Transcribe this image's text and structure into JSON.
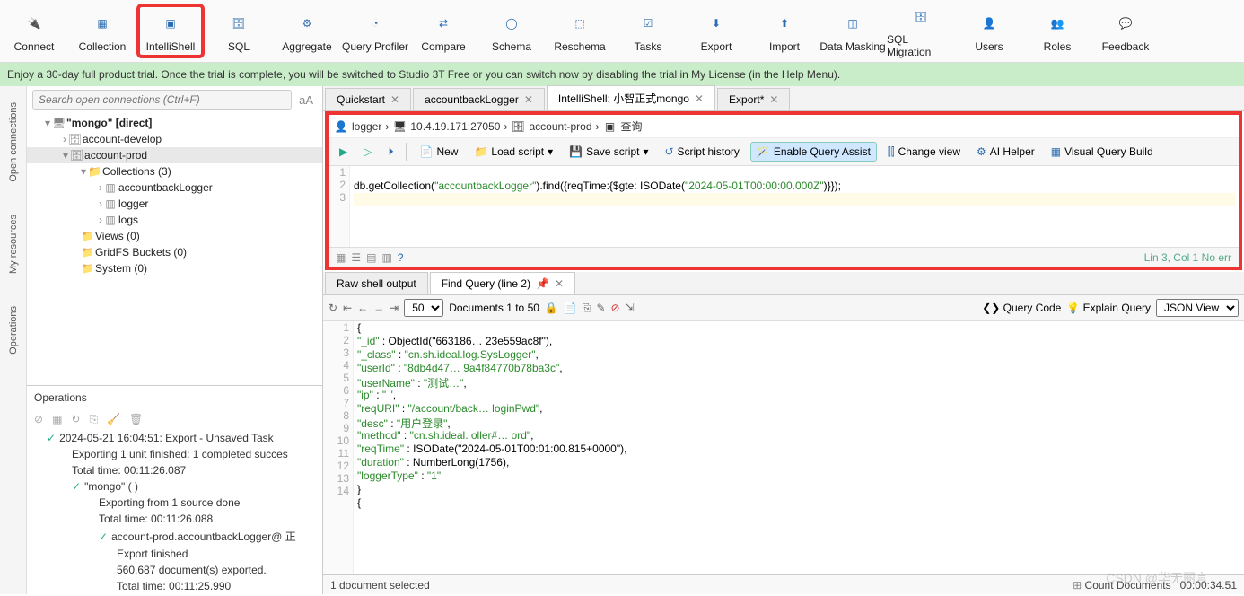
{
  "toolbar": [
    {
      "id": "connect",
      "label": "Connect"
    },
    {
      "id": "collection",
      "label": "Collection"
    },
    {
      "id": "intellishell",
      "label": "IntelliShell",
      "highlight": true
    },
    {
      "id": "sql",
      "label": "SQL"
    },
    {
      "id": "aggregate",
      "label": "Aggregate"
    },
    {
      "id": "queryprofiler",
      "label": "Query Profiler"
    },
    {
      "id": "compare",
      "label": "Compare"
    },
    {
      "id": "schema",
      "label": "Schema"
    },
    {
      "id": "reschema",
      "label": "Reschema"
    },
    {
      "id": "tasks",
      "label": "Tasks"
    },
    {
      "id": "export",
      "label": "Export"
    },
    {
      "id": "import",
      "label": "Import"
    },
    {
      "id": "datamasking",
      "label": "Data Masking"
    },
    {
      "id": "sqlmigration",
      "label": "SQL Migration"
    },
    {
      "id": "users",
      "label": "Users"
    },
    {
      "id": "roles",
      "label": "Roles"
    },
    {
      "id": "feedback",
      "label": "Feedback"
    }
  ],
  "banner": "Enjoy a 30-day full product trial. Once the trial is complete, you will be switched to Studio 3T Free or you can switch now by disabling the trial in My License (in the Help Menu).",
  "left": {
    "search_placeholder": "Search open connections (Ctrl+F)",
    "side_tabs": [
      "Open connections",
      "My resources",
      "Operations"
    ],
    "tree": {
      "root": "\"mongo\"            [direct]",
      "items": [
        "account-develop",
        "account-prod",
        "Collections (3)",
        "accountbackLogger",
        "logger",
        "logs",
        "Views (0)",
        "GridFS Buckets (0)",
        "System (0)"
      ]
    },
    "ops_header": "Operations",
    "ops": [
      {
        "t": "2024-05-21 16:04:51:  Export - Unsaved Task"
      },
      {
        "t": "Exporting 1 unit finished: 1 completed succes"
      },
      {
        "t": "Total time: 00:11:26.087"
      },
      {
        "t": "\"mongo\" (                        )"
      },
      {
        "t": "Exporting from 1 source done"
      },
      {
        "t": "Total time: 00:11:26.088"
      },
      {
        "t": "account-prod.accountbackLogger@      正"
      },
      {
        "t": "Export finished"
      },
      {
        "t": "560,687 document(s) exported."
      },
      {
        "t": "Total time: 00:11:25.990"
      }
    ]
  },
  "tabs": [
    {
      "label": "Quickstart"
    },
    {
      "label": "accountbackLogger"
    },
    {
      "label": "IntelliShell: 小智正式mongo",
      "active": true
    },
    {
      "label": "Export*"
    }
  ],
  "crumb": {
    "user": "logger",
    "host": "10.4.19.171:27050",
    "db": "account-prod",
    "cmd": "查询"
  },
  "querybar": {
    "new": "New",
    "load": "Load script",
    "save": "Save script",
    "history": "Script history",
    "assist": "Enable Query Assist",
    "changeview": "Change view",
    "aihelper": "AI Helper",
    "vqb": "Visual Query Build"
  },
  "editor": {
    "lines": [
      "1",
      "2",
      "3"
    ],
    "code": "db.getCollection(\"accountbackLogger\").find({reqTime:{$gte: ISODate(\"2024-05-01T00:00:00.000Z\")}});"
  },
  "status_right": "Lin 3, Col 1  No err",
  "result_tabs": [
    "Raw shell output",
    "Find Query (line 2)"
  ],
  "result_bar": {
    "page_size": "50",
    "docs": "Documents 1 to 50",
    "query_code": "Query Code",
    "explain": "Explain Query",
    "view": "JSON View"
  },
  "result_lines": [
    "1",
    "2",
    "3",
    "4",
    "5",
    "6",
    "7",
    "8",
    "9",
    "10",
    "11",
    "12",
    "13",
    "14"
  ],
  "result_json": [
    "{",
    "    \"_id\" : ObjectId(\"663186…        23e559ac8f\"),",
    "    \"_class\" : \"cn.sh.ideal.log.SysLogger\",",
    "    \"userId\" : \"8db4d47…         9a4f84770b78ba3c\",",
    "    \"userName\" : \"测试…\",",
    "    \"ip\" : \"         \",",
    "    \"reqURI\" : \"/account/back…   loginPwd\",",
    "    \"desc\" : \"用户登录\",",
    "    \"method\" : \"cn.sh.ideal.                                   oller#…            ord\",",
    "    \"reqTime\" : ISODate(\"2024-05-01T00:01:00.815+0000\"),",
    "    \"duration\" : NumberLong(1756),",
    "    \"loggerType\" : \"1\"",
    "}",
    "{"
  ],
  "bottom": {
    "left": "1 document selected",
    "mid": "Count Documents",
    "right": "00:00:34.51"
  },
  "watermark": "CSDN @华无丽言"
}
